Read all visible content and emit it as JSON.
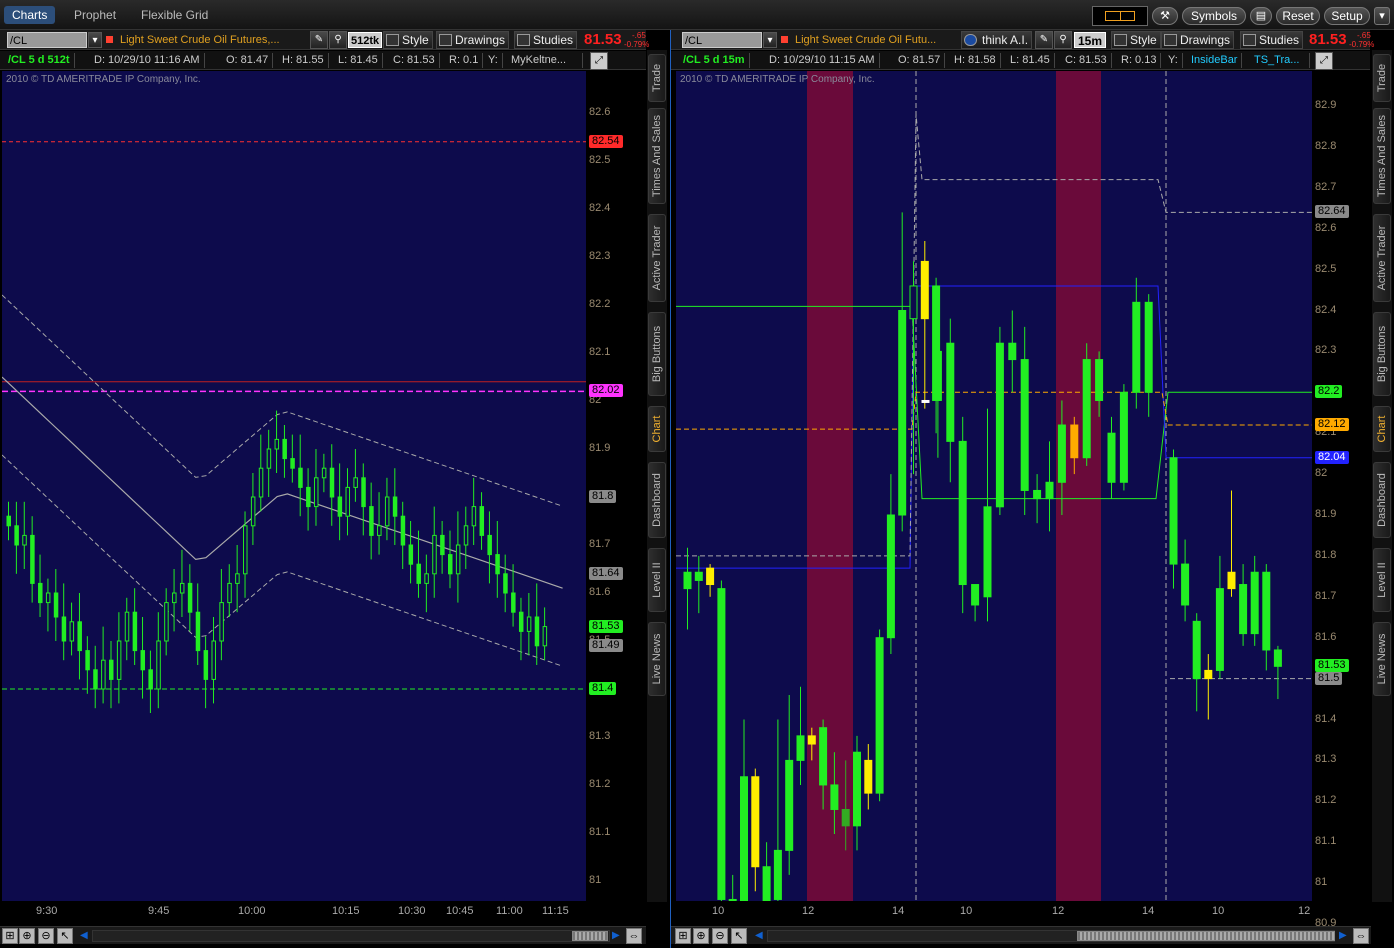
{
  "top_tabs": [
    "Charts",
    "Prophet",
    "Flexible Grid"
  ],
  "top_buttons": {
    "symbols": "Symbols",
    "reset": "Reset",
    "setup": "Setup"
  },
  "sidebar_tabs": [
    "Trade",
    "Times And Sales",
    "Active Trader",
    "Big Buttons",
    "Chart",
    "Dashboard",
    "Level II",
    "Live News"
  ],
  "copyright": "2010 © TD AMERITRADE IP Company, Inc.",
  "left": {
    "symbol": "/CL",
    "description": "Light Sweet Crude Oil Futures,...",
    "aggregation": "512tk",
    "style": "Style",
    "drawings": "Drawings",
    "studies": "Studies",
    "price": "81.53",
    "change": "-.65",
    "change_pct": "-0.79%",
    "chart_label": "/CL 5 d 512t",
    "info": {
      "D": "D: 10/29/10 11:16 AM",
      "O": "O: 81.47",
      "H": "H: 81.55",
      "L": "L: 81.45",
      "C": "C: 81.53",
      "R": "R: 0.1",
      "Y": "Y:",
      "study": "MyKeltne..."
    },
    "y_ticks": [
      "82.6",
      "82.5",
      "82.4",
      "82.3",
      "82.2",
      "82.1",
      "82",
      "81.9",
      "81.8",
      "81.7",
      "81.6",
      "81.5",
      "81.4",
      "81.3",
      "81.2",
      "81.1",
      "81"
    ],
    "price_boxes": [
      {
        "value": "82.54",
        "color": "#ff2a2a"
      },
      {
        "value": "82.02",
        "color": "#ff33ff"
      },
      {
        "value": "81.8",
        "color": "#8a8a8a"
      },
      {
        "value": "81.64",
        "color": "#8a8a8a"
      },
      {
        "value": "81.53",
        "color": "#22ee22"
      },
      {
        "value": "81.49",
        "color": "#8a8a8a"
      },
      {
        "value": "81.4",
        "color": "#22ee22"
      }
    ],
    "x_ticks": [
      "9:30",
      "9:45",
      "10:00",
      "10:15",
      "10:30",
      "10:45",
      "11:00",
      "11:15"
    ]
  },
  "right": {
    "symbol": "/CL",
    "description": "Light Sweet Crude Oil Futu...",
    "think": "think A.I.",
    "aggregation": "15m",
    "style": "Style",
    "drawings": "Drawings",
    "studies": "Studies",
    "price": "81.53",
    "change": "-.65",
    "change_pct": "-0.79%",
    "chart_label": "/CL 5 d 15m",
    "info": {
      "D": "D: 10/29/10 11:15 AM",
      "O": "O: 81.57",
      "H": "H: 81.58",
      "L": "L: 81.45",
      "C": "C: 81.53",
      "R": "R: 0.13",
      "Y": "Y:",
      "study1": "InsideBar",
      "study2": "TS_Tra..."
    },
    "y_ticks": [
      "82.9",
      "82.8",
      "82.7",
      "82.6",
      "82.5",
      "82.4",
      "82.3",
      "82.2",
      "82.1",
      "82",
      "81.9",
      "81.8",
      "81.7",
      "81.6",
      "81.5",
      "81.4",
      "81.3",
      "81.2",
      "81.1",
      "81",
      "80.9"
    ],
    "price_boxes": [
      {
        "value": "82.64",
        "color": "#8a8a8a"
      },
      {
        "value": "82.2",
        "color": "#22ee22"
      },
      {
        "value": "82.12",
        "color": "#ffaa00"
      },
      {
        "value": "82.04",
        "color": "#2222ff"
      },
      {
        "value": "81.53",
        "color": "#22ee22"
      },
      {
        "value": "81.5",
        "color": "#8a8a8a"
      }
    ],
    "x_ticks": [
      "10",
      "12",
      "14",
      "10",
      "12",
      "14",
      "10",
      "12"
    ]
  },
  "colors": {
    "plot_bg": "#0d0b4c",
    "up": "#22ee22",
    "down": "#22ee22",
    "inside": "#ffee00",
    "highlight": "#6a0a3a"
  }
}
